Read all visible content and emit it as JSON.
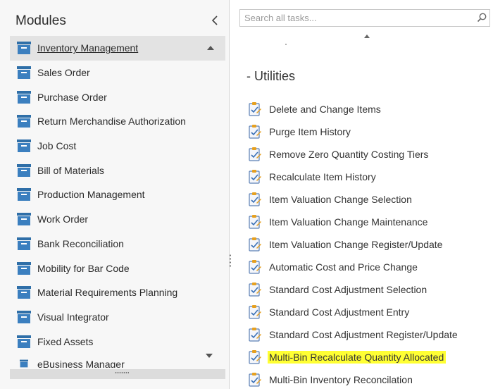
{
  "modules": {
    "title": "Modules",
    "items": [
      {
        "label": "Inventory Management",
        "selected": true
      },
      {
        "label": "Sales Order"
      },
      {
        "label": "Purchase Order"
      },
      {
        "label": "Return Merchandise Authorization"
      },
      {
        "label": "Job Cost"
      },
      {
        "label": "Bill of Materials"
      },
      {
        "label": "Production Management"
      },
      {
        "label": "Work Order"
      },
      {
        "label": "Bank Reconciliation"
      },
      {
        "label": "Mobility for Bar Code"
      },
      {
        "label": "Material Requirements Planning"
      },
      {
        "label": "Visual Integrator"
      },
      {
        "label": "Fixed Assets"
      },
      {
        "label": "eBusiness Manager"
      }
    ]
  },
  "search": {
    "placeholder": "Search all tasks...",
    "value": ""
  },
  "section": {
    "label": "-  Utilities"
  },
  "tasks": [
    {
      "label": "Delete and Change Items"
    },
    {
      "label": "Purge Item History"
    },
    {
      "label": "Remove Zero Quantity Costing Tiers"
    },
    {
      "label": "Recalculate Item History"
    },
    {
      "label": "Item Valuation Change Selection"
    },
    {
      "label": "Item Valuation Change Maintenance"
    },
    {
      "label": "Item Valuation Change Register/Update"
    },
    {
      "label": "Automatic Cost and Price Change"
    },
    {
      "label": "Standard Cost Adjustment Selection"
    },
    {
      "label": "Standard Cost Adjustment Entry"
    },
    {
      "label": "Standard Cost Adjustment Register/Update"
    },
    {
      "label": "Multi-Bin Recalculate Quantity Allocated",
      "highlighted": true
    },
    {
      "label": "Multi-Bin Inventory Reconcilation"
    }
  ],
  "colors": {
    "module_icon": "#2f6fa8",
    "highlight": "#ffff33",
    "task_icon_accent": "#e6a020"
  }
}
